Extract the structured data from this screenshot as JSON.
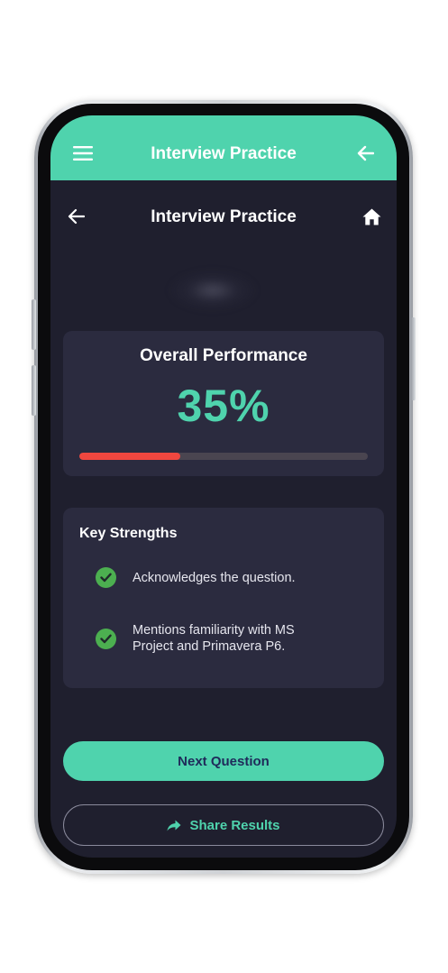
{
  "app_bar": {
    "title": "Interview Practice",
    "menu_icon": "hamburger-menu-icon",
    "back_icon": "arrow-left-icon"
  },
  "page_header": {
    "title": "Interview Practice",
    "back_icon": "arrow-left-icon",
    "home_icon": "home-icon"
  },
  "performance": {
    "title": "Overall Performance",
    "value_text": "35%",
    "progress": 0.35
  },
  "strengths": {
    "title": "Key Strengths",
    "items": [
      {
        "text": "Acknowledges the question.",
        "icon": "check-circle-icon"
      },
      {
        "text": "Mentions familiarity with MS Project and Primavera P6.",
        "icon": "check-circle-icon"
      }
    ]
  },
  "actions": {
    "next_label": "Next Question",
    "share_label": "Share Results",
    "share_icon": "share-arrow-icon"
  },
  "colors": {
    "accent": "#4fd3ad",
    "background": "#1f1f2e",
    "card": "#2b2b3f",
    "progress_fill": "#f0473f",
    "progress_track": "#4a4550",
    "check": "#4caf50"
  }
}
